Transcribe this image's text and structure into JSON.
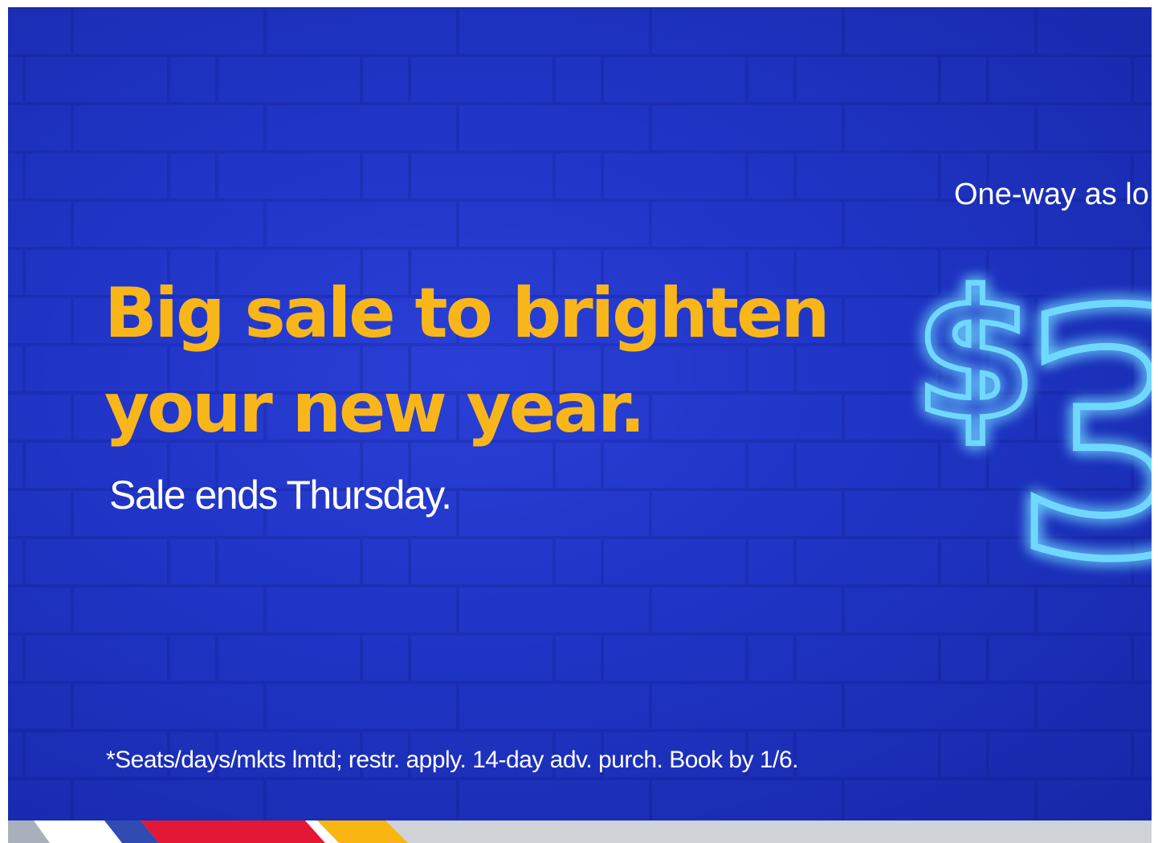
{
  "headline": {
    "line1": "Big sale to brighten",
    "line2": "your new year."
  },
  "subline": "Sale ends Thursday.",
  "promo_label": "One-way as lo",
  "neon_price": {
    "symbol": "$",
    "digit": "3"
  },
  "disclaimer": "*Seats/days/mkts lmtd; restr. apply. 14-day adv. purch. Book by 1/6.",
  "colors": {
    "background": "#1f34c4",
    "headline": "#f9b61b",
    "text": "#ffffff",
    "neon": "#6fd8ff",
    "stripe_blue": "#304cb2",
    "stripe_red": "#e31837",
    "stripe_yellow": "#f9b612",
    "stripe_gray": "#cfd2d6"
  }
}
